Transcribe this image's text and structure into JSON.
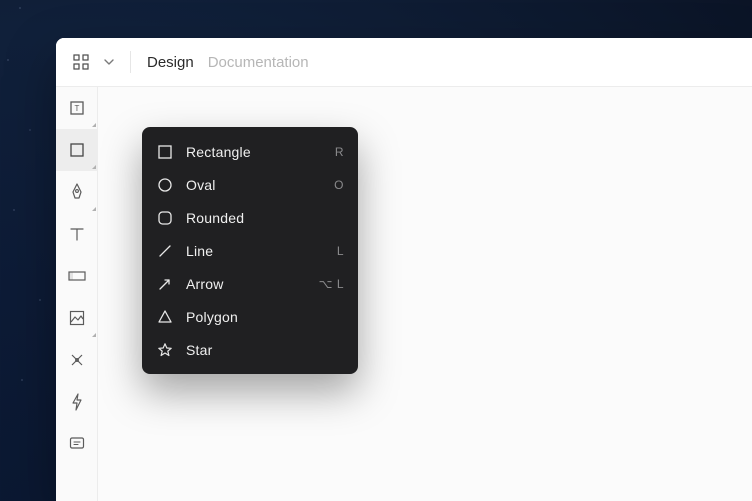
{
  "tabs": {
    "active": "Design",
    "inactive": "Documentation"
  },
  "tool_rail": [
    {
      "name": "artboard-tool"
    },
    {
      "name": "shape-tool",
      "active": true
    },
    {
      "name": "pen-tool"
    },
    {
      "name": "text-tool"
    },
    {
      "name": "slice-tool"
    },
    {
      "name": "image-tool"
    },
    {
      "name": "boolean-tool"
    },
    {
      "name": "prototype-tool"
    },
    {
      "name": "comment-tool"
    }
  ],
  "shape_menu": [
    {
      "label": "Rectangle",
      "shortcut": "R",
      "icon": "rectangle-icon"
    },
    {
      "label": "Oval",
      "shortcut": "O",
      "icon": "oval-icon"
    },
    {
      "label": "Rounded",
      "shortcut": "",
      "icon": "rounded-icon"
    },
    {
      "label": "Line",
      "shortcut": "L",
      "icon": "line-icon"
    },
    {
      "label": "Arrow",
      "shortcut": "⌥ L",
      "icon": "arrow-icon"
    },
    {
      "label": "Polygon",
      "shortcut": "",
      "icon": "polygon-icon"
    },
    {
      "label": "Star",
      "shortcut": "",
      "icon": "star-icon"
    }
  ]
}
